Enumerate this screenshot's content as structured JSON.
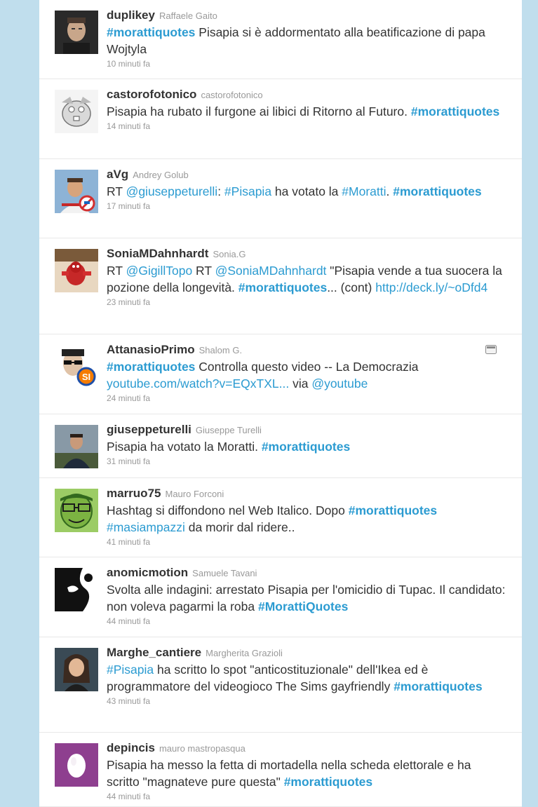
{
  "tweets": [
    {
      "screen_name": "duplikey",
      "full_name": "Raffaele Gaito",
      "segments": [
        {
          "t": "tag",
          "v": "#morattiquotes"
        },
        {
          "t": "text",
          "v": " Pisapia si è addormentato alla beatificazione di papa Wojtyla"
        }
      ],
      "time": "10 minuti fa",
      "avatar": "man-portrait-avatar"
    },
    {
      "screen_name": "castorofotonico",
      "full_name": "castorofotonico",
      "segments": [
        {
          "t": "text",
          "v": "Pisapia ha rubato il furgone ai libici di Ritorno al Futuro. "
        },
        {
          "t": "tag",
          "v": "#morattiquotes"
        }
      ],
      "time": "14 minuti fa",
      "avatar": "beaver-cartoon-avatar"
    },
    {
      "screen_name": "aVg",
      "full_name": "Andrey Golub",
      "segments": [
        {
          "t": "text",
          "v": "RT "
        },
        {
          "t": "link",
          "v": "@giuseppeturelli"
        },
        {
          "t": "text",
          "v": ": "
        },
        {
          "t": "link",
          "v": "#Pisapia"
        },
        {
          "t": "text",
          "v": " ha votato la "
        },
        {
          "t": "link",
          "v": "#Moratti"
        },
        {
          "t": "text",
          "v": ". "
        },
        {
          "t": "tag",
          "v": "#morattiquotes"
        }
      ],
      "time": "17 minuti fa",
      "avatar": "man-with-badge-avatar"
    },
    {
      "screen_name": "SoniaMDahnhardt",
      "full_name": "Sonia.G",
      "segments": [
        {
          "t": "text",
          "v": "RT "
        },
        {
          "t": "link",
          "v": "@GigillTopo"
        },
        {
          "t": "text",
          "v": " RT "
        },
        {
          "t": "link",
          "v": "@SoniaMDahnhardt"
        },
        {
          "t": "text",
          "v": " \"Pisapia vende a tua suocera la pozione della longevità. "
        },
        {
          "t": "tag",
          "v": "#morattiquotes"
        },
        {
          "t": "text",
          "v": "... (cont) "
        },
        {
          "t": "link",
          "v": "http://deck.ly/~oDfd4"
        }
      ],
      "time": "23 minuti fa",
      "avatar": "red-robot-avatar"
    },
    {
      "screen_name": "AttanasioPrimo",
      "full_name": "Shalom G.",
      "segments": [
        {
          "t": "tag",
          "v": "#morattiquotes"
        },
        {
          "t": "text",
          "v": " Controlla questo video -- La Democrazia "
        },
        {
          "t": "link",
          "v": "youtube.com/watch?v=EQxTXL..."
        },
        {
          "t": "text",
          "v": " via "
        },
        {
          "t": "link",
          "v": "@youtube"
        }
      ],
      "time": "24 minuti fa",
      "avatar": "sunglasses-si-avatar",
      "media": true
    },
    {
      "screen_name": "giuseppeturelli",
      "full_name": "Giuseppe Turelli",
      "segments": [
        {
          "t": "text",
          "v": "Pisapia ha votato la Moratti. "
        },
        {
          "t": "tag",
          "v": "#morattiquotes"
        }
      ],
      "time": "31 minuti fa",
      "avatar": "man-outdoors-avatar"
    },
    {
      "screen_name": "marruo75",
      "full_name": "Mauro Forconi",
      "segments": [
        {
          "t": "text",
          "v": "Hashtag si diffondono nel Web Italico. Dopo "
        },
        {
          "t": "tag",
          "v": "#morattiquotes"
        },
        {
          "t": "text",
          "v": " "
        },
        {
          "t": "link",
          "v": "#masiampazzi"
        },
        {
          "t": "text",
          "v": " da morir dal ridere.."
        }
      ],
      "time": "41 minuti fa",
      "avatar": "green-cartoon-face-avatar"
    },
    {
      "screen_name": "anomicmotion",
      "full_name": "Samuele Tavani",
      "segments": [
        {
          "t": "text",
          "v": "Svolta alle indagini: arrestato Pisapia per l'omicidio di Tupac. Il candidato: non voleva pagarmi la roba "
        },
        {
          "t": "tag",
          "v": "#MorattiQuotes"
        }
      ],
      "time": "44 minuti fa",
      "avatar": "black-white-silhouette-avatar"
    },
    {
      "screen_name": "Marghe_cantiere",
      "full_name": "Margherita Grazioli",
      "segments": [
        {
          "t": "link",
          "v": "#Pisapia"
        },
        {
          "t": "text",
          "v": " ha scritto lo spot \"anticostituzionale\" dell'Ikea ed è programmatore del videogioco The Sims gayfriendly "
        },
        {
          "t": "tag",
          "v": "#morattiquotes"
        }
      ],
      "time": "43 minuti fa",
      "avatar": "woman-portrait-avatar"
    },
    {
      "screen_name": "depincis",
      "full_name": "mauro mastropasqua",
      "segments": [
        {
          "t": "text",
          "v": "Pisapia ha messo la fetta di mortadella nella scheda elettorale e ha scritto \"magnateve pure questa\" "
        },
        {
          "t": "tag",
          "v": "#morattiquotes"
        }
      ],
      "time": "44 minuti fa",
      "avatar": "default-egg-avatar"
    }
  ]
}
